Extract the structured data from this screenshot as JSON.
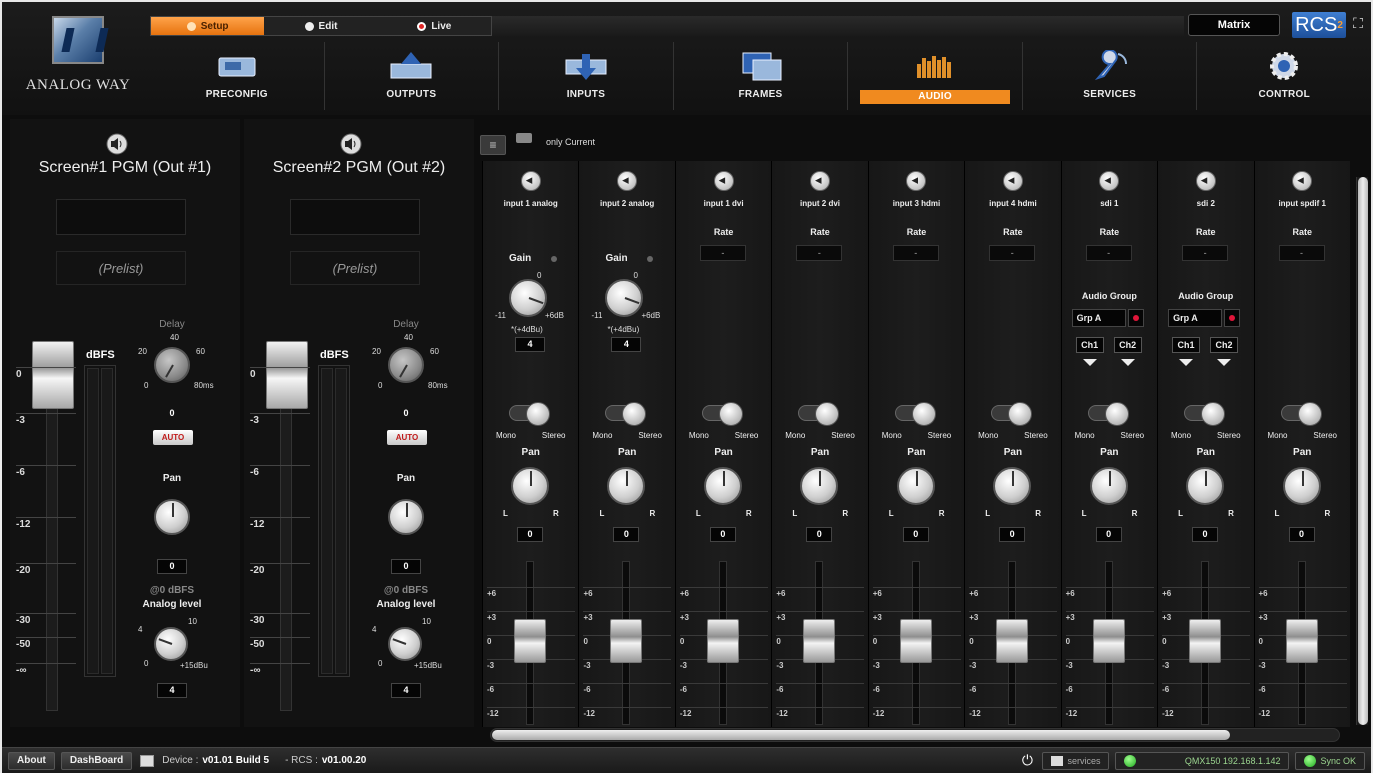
{
  "header": {
    "logo_text": "ANALOG WAY",
    "modes": [
      {
        "label": "Setup",
        "active": true
      },
      {
        "label": "Edit",
        "active": false
      },
      {
        "label": "Live",
        "active": false
      }
    ],
    "matrix_label": "Matrix",
    "rcs_badge": "RCS",
    "rcs_sup": "2",
    "nav": [
      {
        "label": "PRECONFIG",
        "icon": "preconfig-icon"
      },
      {
        "label": "OUTPUTS",
        "icon": "outputs-icon"
      },
      {
        "label": "INPUTS",
        "icon": "inputs-icon"
      },
      {
        "label": "FRAMES",
        "icon": "frames-icon"
      },
      {
        "label": "AUDIO",
        "icon": "audio-icon",
        "active": true
      },
      {
        "label": "SERVICES",
        "icon": "services-icon"
      },
      {
        "label": "CONTROL",
        "icon": "control-icon"
      }
    ]
  },
  "masters": [
    {
      "title": "Screen#1 PGM (Out #1)",
      "prelist": "(Prelist)",
      "dbfs": "dBFS",
      "delay_label": "Delay",
      "delay_value": "0",
      "delay_ticks": [
        "40",
        "20",
        "60",
        "0",
        "80ms"
      ],
      "auto": "AUTO",
      "pan_label": "Pan",
      "pan_value": "0",
      "analog_caption": "@0 dBFS",
      "analog_label": "Analog level",
      "analog_value": "4",
      "analog_ticks": [
        "4",
        "10",
        "0",
        "+15dBu"
      ]
    },
    {
      "title": "Screen#2 PGM (Out #2)",
      "prelist": "(Prelist)",
      "dbfs": "dBFS",
      "delay_label": "Delay",
      "delay_value": "0",
      "delay_ticks": [
        "40",
        "20",
        "60",
        "0",
        "80ms"
      ],
      "auto": "AUTO",
      "pan_label": "Pan",
      "pan_value": "0",
      "analog_caption": "@0 dBFS",
      "analog_label": "Analog level",
      "analog_value": "4",
      "analog_ticks": [
        "4",
        "10",
        "0",
        "+15dBu"
      ]
    }
  ],
  "master_ruler": [
    "0",
    "-3",
    "-6",
    "-12",
    "-20",
    "-30",
    "-50",
    "-∞"
  ],
  "toolbar": {
    "only_current": "only Current"
  },
  "strip_common": {
    "rate": "Rate",
    "rate_value": "-",
    "gain": "Gain",
    "gain_zero": "0",
    "gain_min": "-11",
    "gain_max": "+6dB",
    "gain_note": "*(+4dBu)",
    "audio_group": "Audio Group",
    "ch1": "Ch1",
    "ch2": "Ch2",
    "mono": "Mono",
    "stereo": "Stereo",
    "pan": "Pan",
    "l": "L",
    "r": "R"
  },
  "strip_ruler": [
    "+6",
    "+3",
    "0",
    "-3",
    "-6",
    "-12"
  ],
  "strips": [
    {
      "name": "input 1 analog",
      "type": "analog",
      "gain_value": "4",
      "pan_value": "0"
    },
    {
      "name": "input 2 analog",
      "type": "analog",
      "gain_value": "4",
      "pan_value": "0"
    },
    {
      "name": "input 1 dvi",
      "type": "digital",
      "pan_value": "0"
    },
    {
      "name": "input 2 dvi",
      "type": "digital",
      "pan_value": "0"
    },
    {
      "name": "input 3 hdmi",
      "type": "digital",
      "pan_value": "0"
    },
    {
      "name": "input 4 hdmi",
      "type": "digital",
      "pan_value": "0"
    },
    {
      "name": "sdi 1",
      "type": "sdi",
      "group": "Grp A",
      "pan_value": "0"
    },
    {
      "name": "sdi 2",
      "type": "sdi",
      "group": "Grp A",
      "pan_value": "0"
    },
    {
      "name": "input spdif 1",
      "type": "digital",
      "pan_value": "0"
    }
  ],
  "footer": {
    "about": "About",
    "dashboard": "DashBoard",
    "device_label": "Device :",
    "device_value": "v01.01 Build 5",
    "rcs_label": "- RCS :",
    "rcs_value": "v01.00.20",
    "services": "services",
    "device_ip": "QMX150 192.168.1.142",
    "sync": "Sync OK"
  }
}
